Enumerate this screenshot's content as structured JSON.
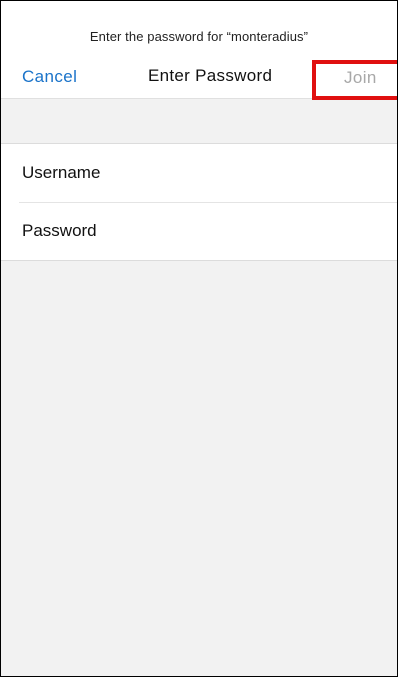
{
  "header": {
    "prompt": "Enter  the password for “monteradius”",
    "cancel_label": "Cancel",
    "title": "Enter Password",
    "join_label": "Join"
  },
  "form": {
    "username_label": "Username",
    "username_value": "",
    "password_label": "Password",
    "password_value": ""
  },
  "colors": {
    "accent": "#1a73c9",
    "disabled": "#a8a8a8",
    "highlight": "#e01010",
    "background": "#f2f2f2"
  }
}
